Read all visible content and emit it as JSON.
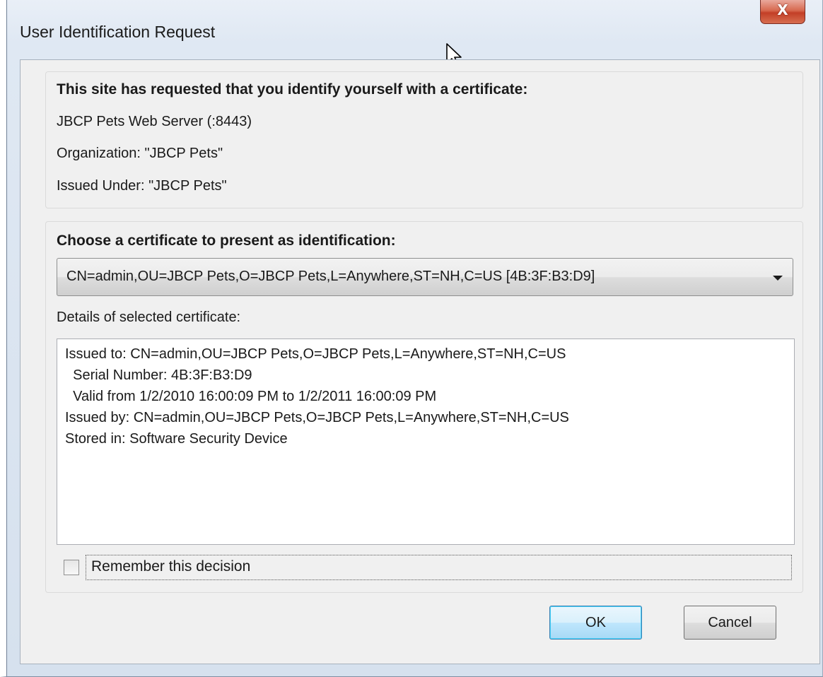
{
  "window": {
    "title": "User Identification Request",
    "close_glyph": "X"
  },
  "site_info": {
    "heading": "This site has requested that you identify yourself with a certificate:",
    "server": "JBCP Pets Web Server (:8443)",
    "organization": "Organization: \"JBCP Pets\"",
    "issued_under": "Issued Under: \"JBCP Pets\""
  },
  "certificate": {
    "heading": "Choose a certificate to present as identification:",
    "selected": "CN=admin,OU=JBCP Pets,O=JBCP Pets,L=Anywhere,ST=NH,C=US [4B:3F:B3:D9]",
    "details_label": "Details of selected certificate:",
    "details_lines": [
      "Issued to: CN=admin,OU=JBCP Pets,O=JBCP Pets,L=Anywhere,ST=NH,C=US",
      "  Serial Number: 4B:3F:B3:D9",
      "  Valid from 1/2/2010 16:00:09 PM to 1/2/2011 16:00:09 PM",
      "Issued by: CN=admin,OU=JBCP Pets,O=JBCP Pets,L=Anywhere,ST=NH,C=US",
      "Stored in: Software Security Device"
    ]
  },
  "remember": {
    "label": "Remember this decision",
    "checked": false
  },
  "buttons": {
    "ok": "OK",
    "cancel": "Cancel"
  },
  "icons": {
    "close": "close-icon",
    "dropdown": "chevron-down-icon",
    "cursor": "mouse-pointer-icon"
  },
  "colors": {
    "close_button": "#c33f27",
    "ok_button_border": "#3c7fb1"
  }
}
